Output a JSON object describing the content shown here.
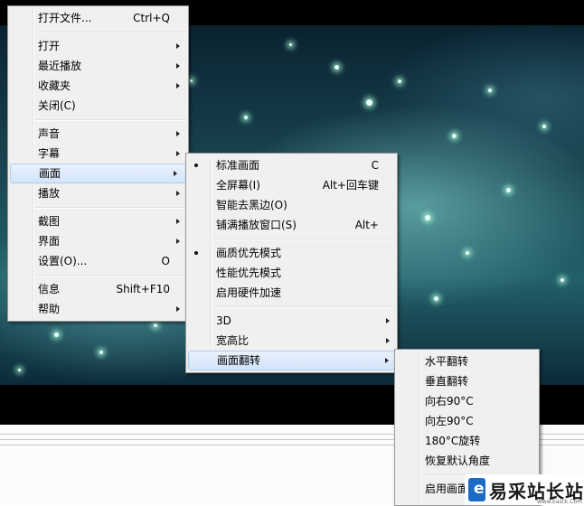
{
  "main_menu": {
    "items": [
      {
        "label": "打开文件...",
        "shortcut": "Ctrl+Q"
      },
      {
        "label": "打开",
        "submenu": true
      },
      {
        "label": "最近播放",
        "submenu": true
      },
      {
        "label": "收藏夹",
        "submenu": true
      },
      {
        "label": "关闭(C)"
      },
      {
        "label": "声音",
        "submenu": true
      },
      {
        "label": "字幕",
        "submenu": true
      },
      {
        "label": "画面",
        "submenu": true,
        "highlighted": true
      },
      {
        "label": "播放",
        "submenu": true
      },
      {
        "label": "截图",
        "submenu": true
      },
      {
        "label": "界面",
        "submenu": true
      },
      {
        "label": "设置(O)...",
        "shortcut": "O"
      },
      {
        "label": "信息",
        "shortcut": "Shift+F10"
      },
      {
        "label": "帮助",
        "submenu": true
      }
    ]
  },
  "picture_menu": {
    "items": [
      {
        "label": "标准画面",
        "shortcut": "C",
        "checked": true
      },
      {
        "label": "全屏幕(I)",
        "shortcut": "Alt+回车键"
      },
      {
        "label": "智能去黑边(O)"
      },
      {
        "label": "铺满播放窗口(S)",
        "shortcut": "Alt+"
      },
      {
        "label": "画质优先模式",
        "checked": true
      },
      {
        "label": "性能优先模式"
      },
      {
        "label": "启用硬件加速"
      },
      {
        "label": "3D",
        "submenu": true
      },
      {
        "label": "宽高比",
        "submenu": true
      },
      {
        "label": "画面翻转",
        "submenu": true,
        "highlighted": true
      }
    ]
  },
  "rotate_menu": {
    "items": [
      {
        "label": "水平翻转"
      },
      {
        "label": "垂直翻转"
      },
      {
        "label": "向右90°C"
      },
      {
        "label": "向左90°C"
      },
      {
        "label": "180°C旋转"
      },
      {
        "label": "恢复默认角度"
      },
      {
        "label": "启用画面"
      }
    ]
  },
  "watermark": {
    "logo_letter": "e",
    "text": "易采站长站",
    "url": "Www.Easck.Com"
  },
  "colors": {
    "menu_bg": "#f0f0f0",
    "highlight": "#d2e4fa",
    "highlight_border": "#aeccf0",
    "watermark_blue": "#1c6cc5"
  }
}
